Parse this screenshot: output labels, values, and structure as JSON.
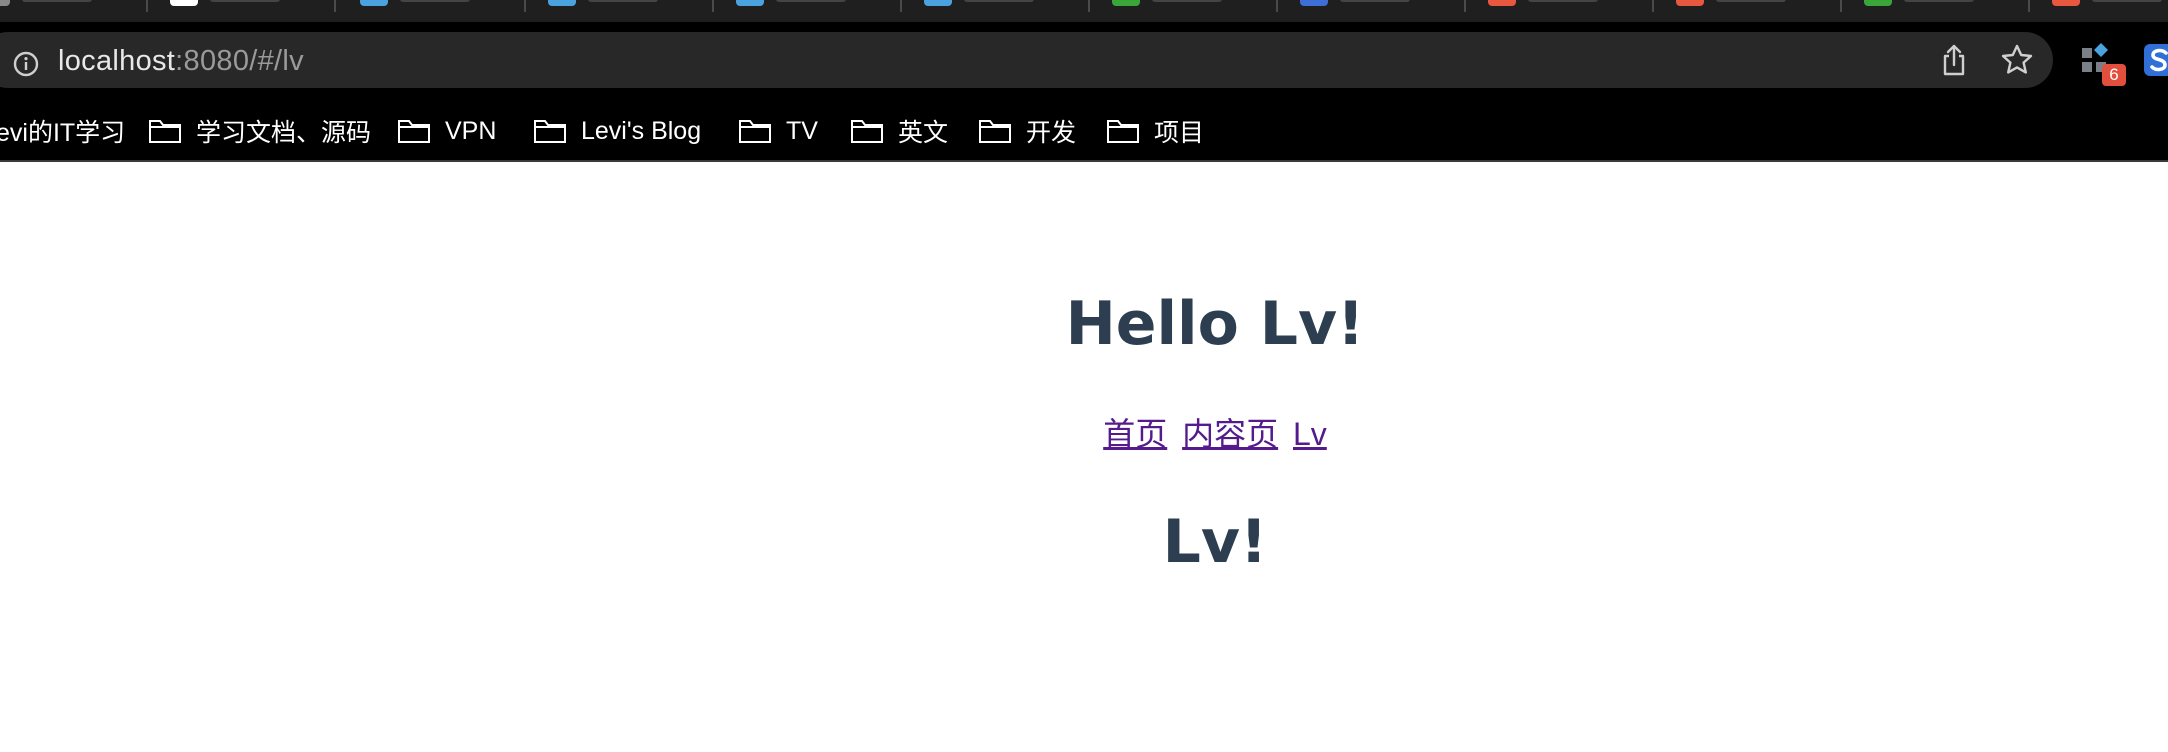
{
  "browser": {
    "url_host": "localhost",
    "url_rest": ":8080/#/lv",
    "extension_badge": "6",
    "tab_favicon_colors": [
      "#888888",
      "#ffffff",
      "#4aa3df",
      "#4aa3df",
      "#4aa3df",
      "#4aa3df",
      "#3aa63a",
      "#3d6fd6",
      "#e8573f",
      "#e8573f",
      "#3aa63a",
      "#e8573f"
    ]
  },
  "bookmarks": [
    {
      "label": "evi的IT学习",
      "icon": "none"
    },
    {
      "label": "学习文档、源码",
      "icon": "folder-icon"
    },
    {
      "label": "VPN",
      "icon": "folder-icon"
    },
    {
      "label": "Levi's Blog",
      "icon": "folder-icon"
    },
    {
      "label": "TV",
      "icon": "folder-icon"
    },
    {
      "label": "英文",
      "icon": "folder-icon"
    },
    {
      "label": "开发",
      "icon": "folder-icon"
    },
    {
      "label": "项目",
      "icon": "folder-icon"
    }
  ],
  "page": {
    "heading": "Hello Lv!",
    "nav_links": [
      "首页",
      "内容页",
      "Lv"
    ],
    "subheading": "Lv!"
  },
  "colors": {
    "heading": "#2c3e50",
    "link_visited": "#551a8b"
  }
}
